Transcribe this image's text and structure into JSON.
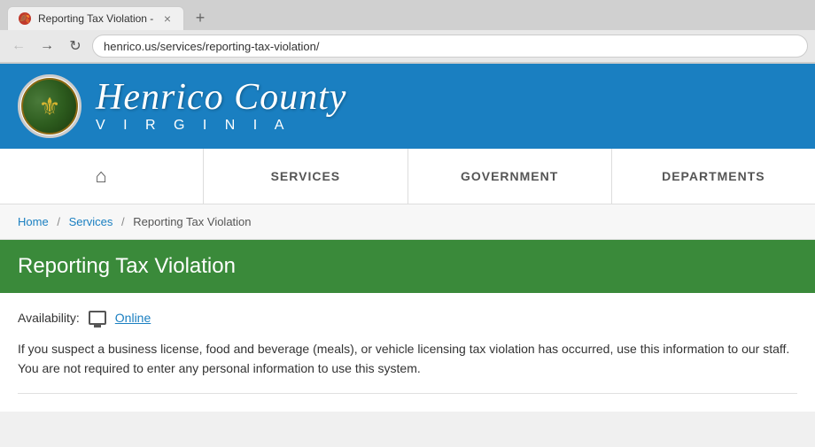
{
  "browser": {
    "tab_title": "Reporting Tax Violation -",
    "tab_close_label": "×",
    "address": "henrico.us/services/reporting-tax-violation/",
    "back_label": "←",
    "forward_label": "→",
    "refresh_label": "↻"
  },
  "header": {
    "county_name": "Henrico County",
    "state": "V I R G I N I A"
  },
  "nav": {
    "home_label": "Home",
    "items": [
      {
        "label": "SERVICES"
      },
      {
        "label": "GOVERNMENT"
      },
      {
        "label": "DEPARTMENTS"
      }
    ]
  },
  "breadcrumb": {
    "home": "Home",
    "services": "Services",
    "current": "Reporting Tax Violation"
  },
  "page": {
    "title": "Reporting Tax Violation",
    "availability_label": "Availability:",
    "availability_icon_name": "monitor-icon",
    "availability_status": "Online",
    "description": "If you suspect a business license, food and beverage (meals), or vehicle licensing tax violation has occurred, use this information to our staff. You are not required to enter any personal information to use this system."
  }
}
